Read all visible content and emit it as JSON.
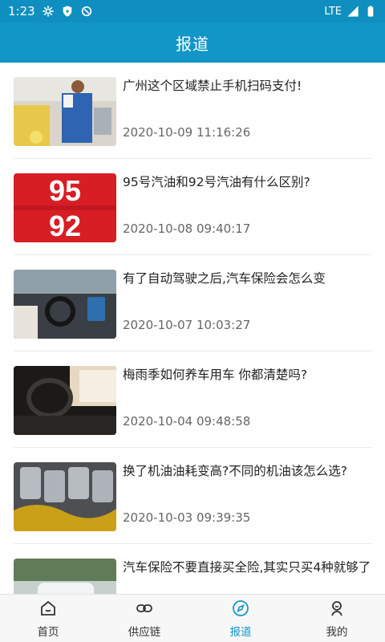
{
  "status_bar": {
    "time": "1:23",
    "network": "LTE"
  },
  "app_bar": {
    "title": "报道"
  },
  "news": [
    {
      "title": "广州这个区域禁止手机扫码支付!",
      "date": "2020-10-09 11:16:26",
      "thumb": "gas-station-attendant"
    },
    {
      "title": "95号汽油和92号汽油有什么区别?",
      "date": "2020-10-08 09:40:17",
      "thumb": "fuel-grade-95-92"
    },
    {
      "title": "有了自动驾驶之后,汽车保险会怎么变",
      "date": "2020-10-07 10:03:27",
      "thumb": "autonomous-car-interior"
    },
    {
      "title": "梅雨季如何养车用车 你都清楚吗?",
      "date": "2020-10-04 09:48:58",
      "thumb": "car-interior-steering"
    },
    {
      "title": "换了机油油耗变高?不同的机油该怎么选?",
      "date": "2020-10-03 09:39:35",
      "thumb": "engine-pistons"
    },
    {
      "title": "汽车保险不要直接买全险,其实只买4种就够了",
      "date": "",
      "thumb": "car-on-road"
    }
  ],
  "bottom_nav": [
    {
      "label": "首页",
      "icon": "home-icon",
      "active": false
    },
    {
      "label": "供应链",
      "icon": "link-icon",
      "active": false
    },
    {
      "label": "报道",
      "icon": "compass-icon",
      "active": true
    },
    {
      "label": "我的",
      "icon": "profile-icon",
      "active": false
    }
  ],
  "colors": {
    "accent": "#1296c8",
    "status": "#0f8fbf"
  }
}
